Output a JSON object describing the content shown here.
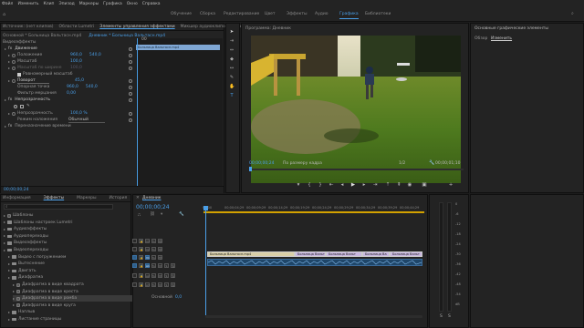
{
  "menu": [
    "Файл",
    "Изменить",
    "Клип",
    "Эпизод",
    "Маркеры",
    "Графика",
    "Окно",
    "Справка"
  ],
  "workspaces": [
    {
      "label": "Обучение",
      "active": false
    },
    {
      "label": "Сборка",
      "active": false
    },
    {
      "label": "Редактирование",
      "active": false
    },
    {
      "label": "Цвет",
      "active": false
    },
    {
      "label": "Эффекты",
      "active": false
    },
    {
      "label": "Аудио",
      "active": false
    },
    {
      "label": "Графика",
      "active": true
    },
    {
      "label": "Библиотеки",
      "active": false
    }
  ],
  "effect_controls": {
    "tabs": [
      "Источник: (нет клипов)",
      "Области Lumetri",
      "Элементы управления эффектами",
      "Микшер аудиоклипов: Дневник"
    ],
    "source_label": "Основной * Больница Вальтасн.mp4",
    "seq_label": "Дневник * Больница Вальтасн.mp4",
    "timecode_top": "00",
    "clip_name": "Больница Вальтасн.mp4",
    "section_video": "Видеоэффекты",
    "fx_motion": "Движение",
    "props": [
      {
        "name": "Положение",
        "v1": "960,0",
        "v2": "540,0",
        "blue": true
      },
      {
        "name": "Масштаб",
        "v1": "100,0",
        "v2": "",
        "blue": true
      },
      {
        "name": "Масштаб по ширине",
        "v1": "100,0",
        "v2": "",
        "blue": false
      }
    ],
    "uniform_scale": "Равномерный масштаб",
    "rotation_name": "Поворот",
    "rotation_val": "45,0",
    "anchor_name": "Опорная точка",
    "anchor_v1": "960,0",
    "anchor_v2": "540,0",
    "antiflicker_name": "Фильтр мерцания",
    "antiflicker_val": "0,00",
    "fx_opacity": "Непрозрачность",
    "opacity_name": "Непрозрачность",
    "opacity_val": "100,0 %",
    "blend_name": "Режим наложения",
    "blend_val": "Обычный",
    "fx_time": "Переназначение времени",
    "timecode_bottom": "00;00;00;24"
  },
  "program": {
    "title": "Программа: Дневник",
    "timecode": "00;00;00;24",
    "fit": "По размеру кадра",
    "quality": "1/2",
    "duration": "00;00;01;10"
  },
  "essential_graphics": {
    "title": "Основные графические элементы",
    "tabs": [
      "Обзор",
      "Изменить"
    ]
  },
  "project": {
    "tabs": [
      "Информация",
      "Эффекты",
      "Маркеры",
      "История"
    ],
    "items": [
      {
        "label": "Шаблоны",
        "indent": 0,
        "folder": false
      },
      {
        "label": "Шаблоны настроек Lumetri",
        "indent": 0,
        "folder": true
      },
      {
        "label": "Аудиоэффекты",
        "indent": 0,
        "folder": true
      },
      {
        "label": "Аудиопереходы",
        "indent": 0,
        "folder": true
      },
      {
        "label": "Видеоэффекты",
        "indent": 0,
        "folder": true
      },
      {
        "label": "Видеопереходы",
        "indent": 0,
        "folder": true
      },
      {
        "label": "Видео с погружением",
        "indent": 1,
        "folder": true
      },
      {
        "label": "Вытеснение",
        "indent": 1,
        "folder": true
      },
      {
        "label": "Двигать",
        "indent": 1,
        "folder": true
      },
      {
        "label": "Диафрагма",
        "indent": 1,
        "folder": true
      },
      {
        "label": "Диафрагма в виде квадрата",
        "indent": 2,
        "folder": false
      },
      {
        "label": "Диафрагма в виде креста",
        "indent": 2,
        "folder": false
      },
      {
        "label": "Диафрагма в виде ромба",
        "indent": 2,
        "folder": false,
        "selected": true
      },
      {
        "label": "Диафрагма в виде круга",
        "indent": 2,
        "folder": false
      },
      {
        "label": "Наплыв",
        "indent": 1,
        "folder": true
      },
      {
        "label": "Листание страницы",
        "indent": 1,
        "folder": true
      }
    ]
  },
  "timeline": {
    "title": "Дневник",
    "timecode": "00;00;00;24",
    "ticks": [
      "00;00",
      "00;00;04;29",
      "00;00;09;29",
      "00;00;14;29",
      "00;00;19;29",
      "00;00;24;29",
      "00;00;29;29",
      "00;00;34;29",
      "00;00;39;29",
      "00;00;44;29"
    ],
    "tracks": [
      {
        "id": "V3",
        "type": "video"
      },
      {
        "id": "V2",
        "type": "video"
      },
      {
        "id": "V1",
        "type": "video",
        "active": true
      },
      {
        "id": "A1",
        "type": "audio",
        "active": true
      },
      {
        "id": "A2",
        "type": "audio"
      },
      {
        "id": "A3",
        "type": "audio"
      }
    ],
    "master_label": "Основной",
    "master_val": "0,0",
    "clips": [
      "Больница Вальтасн.mp4",
      "Больница Вальт",
      "Больница Вальт",
      "Больница Ва",
      "Больница Вальт"
    ]
  },
  "meter": {
    "labels": [
      "0",
      "-6",
      "-12",
      "-18",
      "-24",
      "-30",
      "-36",
      "-42",
      "-48",
      "-54",
      "dB"
    ],
    "bottom": [
      "S",
      "S"
    ]
  }
}
